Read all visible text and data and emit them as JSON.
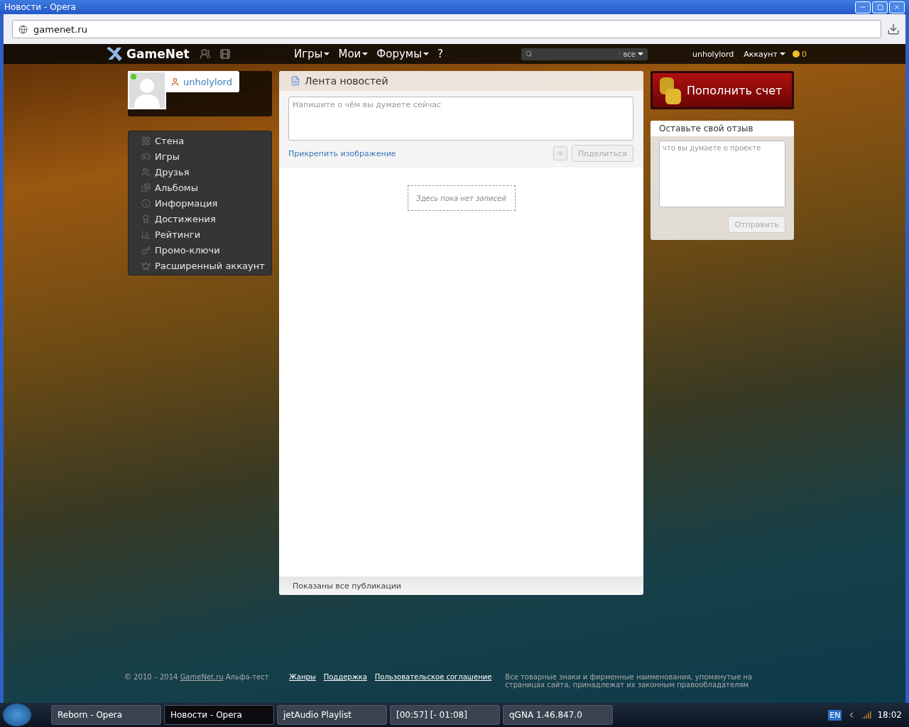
{
  "window": {
    "title": "Новости - Opera"
  },
  "address_bar": {
    "url": "gamenet.ru"
  },
  "site_nav": {
    "logo": "GameNet",
    "menus": [
      {
        "label": "Игры"
      },
      {
        "label": "Мои"
      },
      {
        "label": "Форумы"
      }
    ],
    "help": "?",
    "search": {
      "scope": "все"
    },
    "username": "unholylord",
    "account": "Аккаунт",
    "coins": "0"
  },
  "profile": {
    "username": "unholylord",
    "online": true
  },
  "sidebar": {
    "items": [
      {
        "label": "Стена"
      },
      {
        "label": "Игры"
      },
      {
        "label": "Друзья"
      },
      {
        "label": "Альбомы"
      },
      {
        "label": "Информация"
      },
      {
        "label": "Достижения"
      },
      {
        "label": "Рейтинги"
      },
      {
        "label": "Промо-ключи"
      },
      {
        "label": "Расширенный аккаунт"
      }
    ]
  },
  "feed": {
    "title": "Лента новостей",
    "composer": {
      "placeholder": "Напишите о чём вы думаете сейчас"
    },
    "attach_link": "Прикрепить изображение",
    "share_button": {
      "label": "Поделиться",
      "disabled": true
    },
    "empty_message": "Здесь пока нет записей",
    "footer_text": "Показаны все публикации"
  },
  "topup_button": "Пополнить счет",
  "feedback": {
    "title": "Оставьте свой отзыв",
    "placeholder": "что вы думаете о проекте",
    "send_button": {
      "label": "Отправить",
      "disabled": true
    }
  },
  "footer": {
    "copyright": "© 2010 – 2014 ",
    "copyright_link": "GameNet.ru",
    "copyright_suffix": " Альфа-тест",
    "links": [
      "Жанры",
      "Поддержка",
      "Пользовательское соглашение"
    ],
    "disclaimer": "Все товарные знаки и фирменные наименования, упомянутые на страницах сайта, принадлежат их законным правообладателям"
  },
  "taskbar": {
    "items": [
      {
        "label": "Reborn - Opera",
        "selected": false
      },
      {
        "label": "Новости - Opera",
        "selected": true
      },
      {
        "label": "jetAudio Playlist",
        "selected": false
      },
      {
        "label": "[00:57] [- 01:08]",
        "selected": false
      },
      {
        "label": "qGNA 1.46.847.0",
        "selected": false
      }
    ],
    "language": "EN",
    "time": "18:02"
  }
}
